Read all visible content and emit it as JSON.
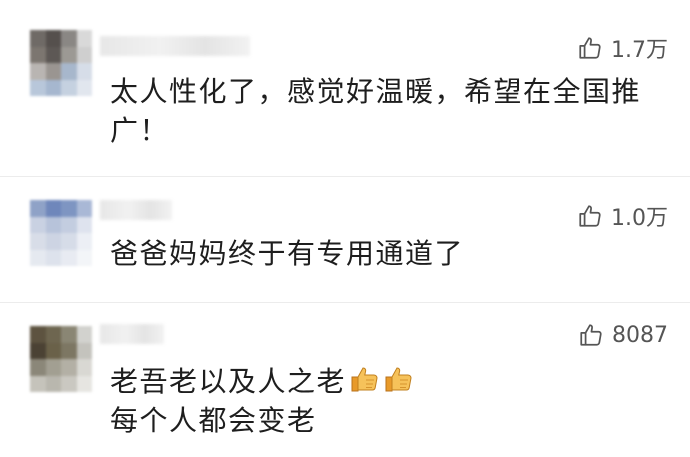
{
  "comments": [
    {
      "likes": "1.7万",
      "lines": [
        "太人性化了，感觉好温暖，希望在全国推",
        "广！"
      ]
    },
    {
      "likes": "1.0万",
      "lines": [
        "爸爸妈妈终于有专用通道了"
      ]
    },
    {
      "likes": "8087",
      "lines": [
        "老吾老以及人之老",
        "每个人都会变老"
      ],
      "emoji": [
        "thumbs-up",
        "thumbs-up"
      ]
    }
  ],
  "colors": {
    "text": "#1e1e1e",
    "like": "#555555",
    "emoji": "#f2b13e"
  },
  "icons": {
    "like": "thumbs-up-outline-icon"
  }
}
